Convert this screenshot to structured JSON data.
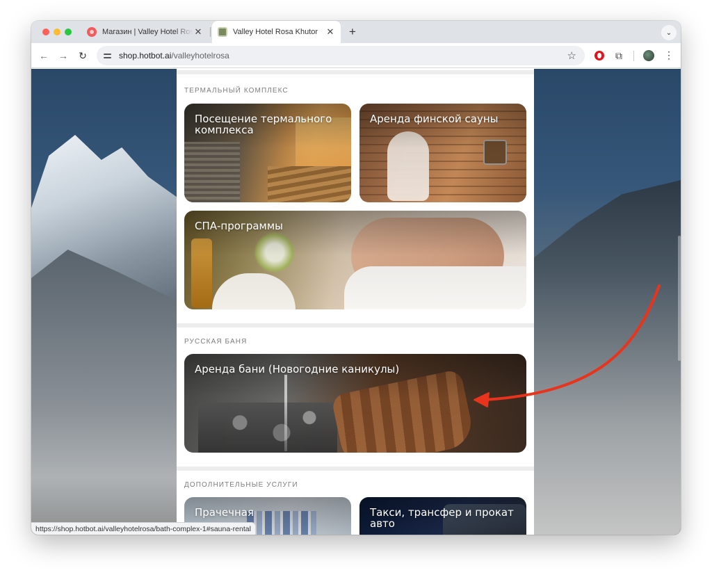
{
  "browser": {
    "tabs": [
      {
        "title": "Магазин | Valley Hotel Rosa Khutor",
        "active": false,
        "favicon": "shop-favicon-icon"
      },
      {
        "title": "Valley Hotel Rosa Khutor",
        "active": true,
        "favicon": "hotel-favicon-icon"
      }
    ],
    "new_tab": "+",
    "tab_menu": "⌄",
    "url_host": "shop.hotbot.ai",
    "url_path": "/valleyhotelrosa",
    "nav": {
      "back": "←",
      "forward": "→",
      "reload": "↻"
    },
    "icons": {
      "star": "☆",
      "puzzle": "⧉",
      "kebab": "⋮"
    },
    "status_url": "https://shop.hotbot.ai/valleyhotelrosa/bath-complex-1#sauna-rental"
  },
  "sections": [
    {
      "title": "ТЕРМАЛЬНЫЙ КОМПЛЕКС",
      "cards": [
        {
          "label": "Посещение термального комплекса"
        },
        {
          "label": "Аренда финской сауны"
        },
        {
          "label": "СПА-программы"
        }
      ]
    },
    {
      "title": "РУССКАЯ БАНЯ",
      "cards": [
        {
          "label": "Аренда бани (Новогодние каникулы)"
        }
      ]
    },
    {
      "title": "ДОПОЛНИТЕЛЬНЫЕ УСЛУГИ",
      "cards": [
        {
          "label": "Прачечная"
        },
        {
          "label": "Такси, трансфер и прокат авто"
        }
      ]
    }
  ],
  "colors": {
    "annotation_arrow": "#e8341c",
    "section_title": "#7c7c7c",
    "separator": "#ededed"
  }
}
